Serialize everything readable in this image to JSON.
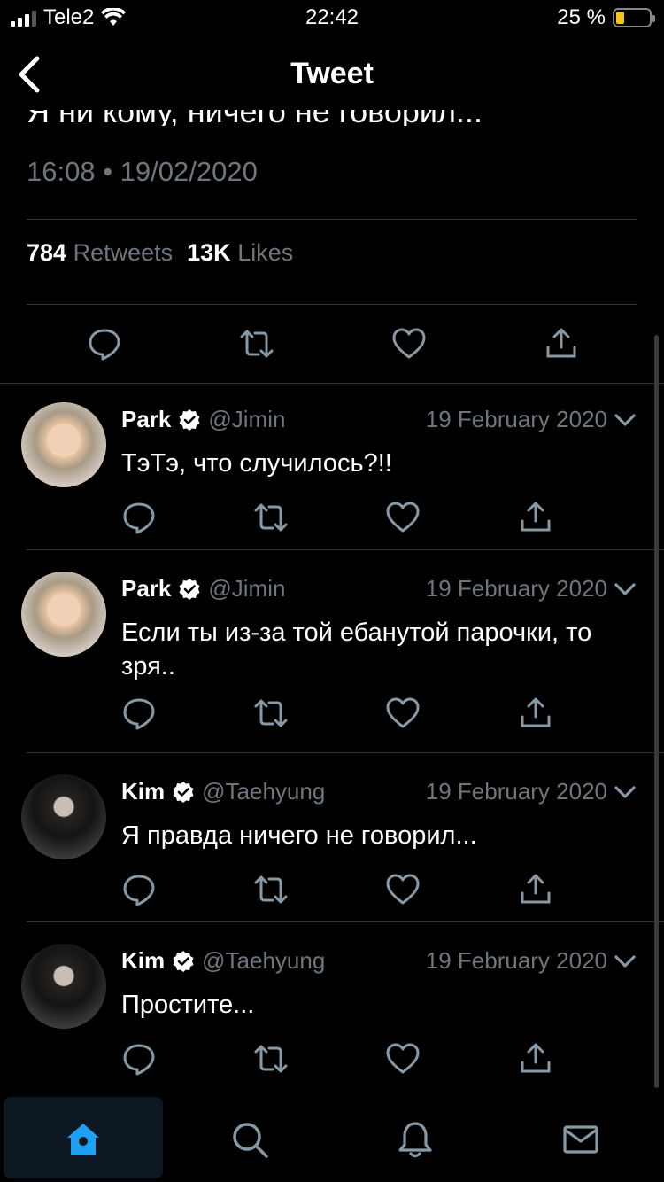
{
  "status_bar": {
    "carrier": "Tele2",
    "time": "22:42",
    "battery": "25 %",
    "battery_level": 0.25
  },
  "nav": {
    "title": "Tweet"
  },
  "tweet": {
    "cut_text": "Я ни кому, ничего не говорил...",
    "timestamp": "16:08 • 19/02/2020",
    "retweets_count": "784",
    "retweets_label": "Retweets",
    "likes_count": "13K",
    "likes_label": "Likes"
  },
  "replies": [
    {
      "name": "Park",
      "handle": "@Jimin",
      "date": "19 February 2020",
      "text": "ТэТэ, что случилось?!!",
      "avatar": "park"
    },
    {
      "name": "Park",
      "handle": "@Jimin",
      "date": "19 February 2020",
      "text": "Если ты из-за той ебанутой парочки, то зря..",
      "avatar": "park"
    },
    {
      "name": "Kim",
      "handle": "@Taehyung",
      "date": "19 February 2020",
      "text": "Я правда ничего не говорил...",
      "avatar": "kim"
    },
    {
      "name": "Kim",
      "handle": "@Taehyung",
      "date": "19 February 2020",
      "text": "Простите...",
      "avatar": "kim"
    }
  ],
  "tabbar": {
    "icons": [
      "home-icon",
      "search-icon",
      "bell-icon",
      "mail-icon"
    ]
  },
  "colors": {
    "background": "#000000",
    "muted": "#6e767d",
    "accent": "#1da1f2",
    "divider": "#2f3336"
  }
}
